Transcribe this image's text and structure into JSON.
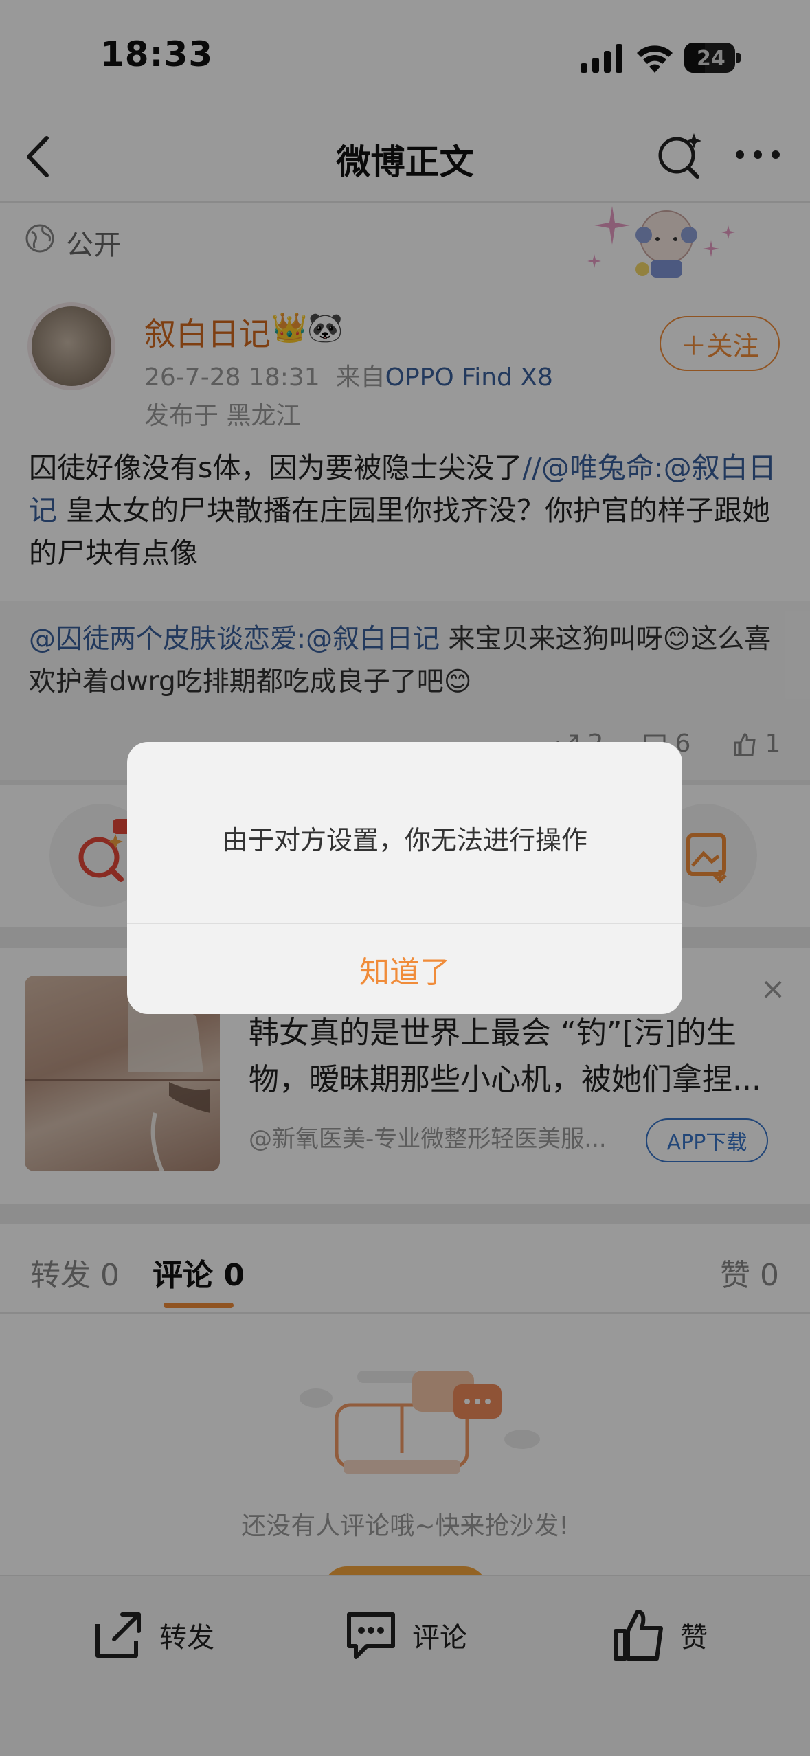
{
  "status_bar": {
    "time": "18:33",
    "battery": "24"
  },
  "nav": {
    "title": "微博正文"
  },
  "visibility": {
    "label": "公开"
  },
  "post": {
    "username": "叙白日记",
    "badges": "👑🐼",
    "follow_label": "＋关注",
    "time": "26-7-28 18:31",
    "from_prefix": "来自",
    "source": "OPPO Find X8",
    "location": "发布于 黑龙江",
    "body_text": "囚徒好像没有s体，因为要被隐士尖没了",
    "body_mention1": "//@唯兔命:@叙白日记",
    "body_text2": " 皇太女的尸块散播在庄园里你找齐没？你护官的样子跟她的尸块有点像"
  },
  "quote": {
    "mention": "@囚徒两个皮肤谈恋爱:@叙白日记",
    "text1": " 来宝贝来这狗叫呀",
    "emoji1": "😊",
    "text2": "这么喜欢护着dwrg吃排期都吃成良子了吧",
    "emoji2": "😊",
    "reposts": "2",
    "comments": "6",
    "likes": "1"
  },
  "ad": {
    "title": "韩女真的是世界上最会 “钓”[污]的生物，暧昧期那些小心机，被她们拿捏...",
    "source": "@新氧医美-专业微整形轻医美服...",
    "button": "APP下载",
    "close": "×"
  },
  "tabs": {
    "repost": "转发 0",
    "comment": "评论 0",
    "like": "赞 0"
  },
  "empty": {
    "text": "还没有人评论哦~快来抢沙发!"
  },
  "bottom_bar": {
    "repost": "转发",
    "comment": "评论",
    "like": "赞"
  },
  "dialog": {
    "message": "由于对方设置，你无法进行操作",
    "button": "知道了"
  },
  "colors": {
    "accent": "#f08c3a",
    "link": "#3a5f9c",
    "ad_button": "#3a76c8"
  }
}
